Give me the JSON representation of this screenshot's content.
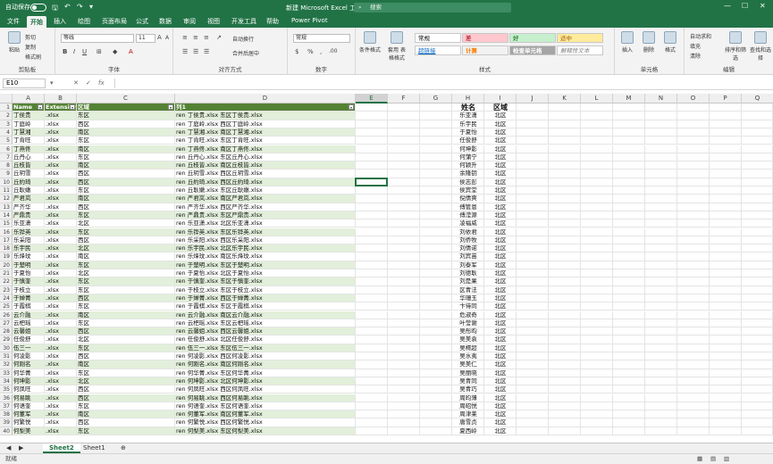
{
  "titlebar": {
    "autosave_label": "自动保存",
    "autosave_state": "关",
    "doc_title": "新建 Microsoft Excel 工作表.xlsx",
    "search_placeholder": "搜索"
  },
  "tabs": [
    "文件",
    "开始",
    "插入",
    "绘图",
    "页面布局",
    "公式",
    "数据",
    "审阅",
    "视图",
    "开发工具",
    "帮助",
    "Power Pivot"
  ],
  "ribbon": {
    "clipboard": {
      "paste": "粘贴",
      "cut": "剪切",
      "copy": "复制",
      "format_painter": "格式刷",
      "label": "剪贴板"
    },
    "font": {
      "name": "等线",
      "size": "11",
      "label": "字体"
    },
    "align": {
      "wrap": "自动换行",
      "merge": "合并后居中",
      "label": "对齐方式"
    },
    "number": {
      "format": "常规",
      "label": "数字"
    },
    "styles": {
      "cond_format": "条件格式",
      "table_format": "套用\n表格格式",
      "label": "样式",
      "boxes": [
        "常规",
        "差",
        "好",
        "适中",
        "超链接",
        "计算",
        "检查单元格",
        "解释性文本"
      ]
    },
    "cells": {
      "insert": "插入",
      "delete": "删除",
      "format": "格式",
      "label": "单元格"
    },
    "editing": {
      "autosum": "自动求和",
      "fill": "填充",
      "clear": "清除",
      "sort": "排序和筛选",
      "find": "查找和选择",
      "label": "编辑"
    }
  },
  "formula_bar": {
    "name_box": "E10",
    "fx": "fx",
    "formula": ""
  },
  "columns": [
    "A",
    "B",
    "C",
    "D",
    "E",
    "F",
    "G",
    "H",
    "I",
    "J",
    "K",
    "L",
    "M",
    "N",
    "O",
    "P",
    "Q",
    "R"
  ],
  "table": {
    "headers": [
      "Name",
      "Extension",
      "区域",
      "列1"
    ],
    "rows": [
      [
        "丁侯贵",
        ".xlsx",
        "东区",
        "ren 丁侯贵.xlsx 东区丁侯贵.xlsx"
      ],
      [
        "丁庭岭",
        ".xlsx",
        "西区",
        "ren 丁庭岭.xlsx 西区丁庭岭.xlsx"
      ],
      [
        "丁慧湘",
        ".xlsx",
        "南区",
        "ren 丁慧湘.xlsx 南区丁慧湘.xlsx"
      ],
      [
        "丁肯旺",
        ".xlsx",
        "东区",
        "ren 丁肯旺.xlsx 东区丁肯旺.xlsx"
      ],
      [
        "丁燕佟",
        ".xlsx",
        "南区",
        "ren 丁燕佟.xlsx 南区丁燕佟.xlsx"
      ],
      [
        "丘丹心",
        ".xlsx",
        "东区",
        "ren 丘丹心.xlsx 东区丘丹心.xlsx"
      ],
      [
        "丘枝皆",
        ".xlsx",
        "南区",
        "ren 丘枝皆.xlsx 南区丘枝皆.xlsx"
      ],
      [
        "丘玥雪",
        ".xlsx",
        "西区",
        "ren 丘玥雪.xlsx 西区丘玥雪.xlsx"
      ],
      [
        "丘約琦",
        ".xlsx",
        "西区",
        "ren 丘約琦.xlsx 西区丘約琦.xlsx"
      ],
      [
        "丘耿嫩",
        ".xlsx",
        "东区",
        "ren 丘耿嫩.xlsx 东区丘耿嫩.xlsx"
      ],
      [
        "严君岚",
        ".xlsx",
        "南区",
        "ren 严君岚.xlsx 南区严君岚.xlsx"
      ],
      [
        "严齐华",
        ".xlsx",
        "西区",
        "ren 严齐华.xlsx 西区严齐华.xlsx"
      ],
      [
        "严鼎贵",
        ".xlsx",
        "东区",
        "ren 严鼎贵.xlsx 东区严鼎贵.xlsx"
      ],
      [
        "乐亚潇",
        ".xlsx",
        "北区",
        "ren 乐亚潇.xlsx 北区乐亚潇.xlsx"
      ],
      [
        "乐铧英",
        ".xlsx",
        "东区",
        "ren 乐铧英.xlsx 东区乐铧英.xlsx"
      ],
      [
        "乐采阳",
        ".xlsx",
        "西区",
        "ren 乐采阳.xlsx 西区乐采阳.xlsx"
      ],
      [
        "乐宇民",
        ".xlsx",
        "北区",
        "ren 乐宇民.xlsx 北区乐宇民.xlsx"
      ],
      [
        "乐烽玟",
        ".xlsx",
        "南区",
        "ren 乐烽玟.xlsx 南区乐烽玟.xlsx"
      ],
      [
        "于楚明",
        ".xlsx",
        "东区",
        "ren 于楚明.xlsx 东区于楚明.xlsx"
      ],
      [
        "于夏怡",
        ".xlsx",
        "北区",
        "ren 于夏怡.xlsx 北区于夏怡.xlsx"
      ],
      [
        "于慎奎",
        ".xlsx",
        "东区",
        "ren 于慎奎.xlsx 东区于慎奎.xlsx"
      ],
      [
        "于枝立",
        ".xlsx",
        "东区",
        "ren 于枝立.xlsx 东区于枝立.xlsx"
      ],
      [
        "于婵菁",
        ".xlsx",
        "西区",
        "ren 于婵菁.xlsx 西区于婵菁.xlsx"
      ],
      [
        "于霞棋",
        ".xlsx",
        "东区",
        "ren 于霞棋.xlsx 东区于霞棋.xlsx"
      ],
      [
        "云介融",
        ".xlsx",
        "南区",
        "ren 云介融.xlsx 南区云介融.xlsx"
      ],
      [
        "云杷瑶",
        ".xlsx",
        "东区",
        "ren 云杷瑶.xlsx 东区云杷瑶.xlsx"
      ],
      [
        "云馨姐",
        ".xlsx",
        "西区",
        "ren 云馨姐.xlsx 西区云馨姐.xlsx"
      ],
      [
        "任俊舒",
        ".xlsx",
        "北区",
        "ren 任俊舒.xlsx 北区任俊舒.xlsx"
      ],
      [
        "伍三一",
        ".xlsx",
        "东区",
        "ren 伍三一.xlsx 东区伍三一.xlsx"
      ],
      [
        "何凌影",
        ".xlsx",
        "西区",
        "ren 何凌影.xlsx 西区何凌影.xlsx"
      ],
      [
        "何刚名",
        ".xlsx",
        "南区",
        "ren 何刚名.xlsx 南区何刚名.xlsx"
      ],
      [
        "何华菁",
        ".xlsx",
        "东区",
        "ren 何华菁.xlsx 东区何华菁.xlsx"
      ],
      [
        "何坤影",
        ".xlsx",
        "北区",
        "ren 何坤影.xlsx 北区何坤影.xlsx"
      ],
      [
        "何凤旺",
        ".xlsx",
        "西区",
        "ren 何凤旺.xlsx 西区何凤旺.xlsx"
      ],
      [
        "何易眺",
        ".xlsx",
        "西区",
        "ren 何易眺.xlsx 西区何易眺.xlsx"
      ],
      [
        "何语奎",
        ".xlsx",
        "东区",
        "ren 何语奎.xlsx 东区何语奎.xlsx"
      ],
      [
        "何董军",
        ".xlsx",
        "南区",
        "ren 何董军.xlsx 南区何董军.xlsx"
      ],
      [
        "何繁悦",
        ".xlsx",
        "西区",
        "ren 何繁悦.xlsx 西区何繁悦.xlsx"
      ],
      [
        "何梨美",
        ".xlsx",
        "东区",
        "ren 何梨美.xlsx 东区何梨美.xlsx"
      ]
    ]
  },
  "side_list": {
    "headers": [
      "姓名",
      "区域"
    ],
    "rows": [
      [
        "乐亚潇",
        "北区"
      ],
      [
        "乐宇民",
        "北区"
      ],
      [
        "于夏怡",
        "北区"
      ],
      [
        "任俊舒",
        "北区"
      ],
      [
        "何坤影",
        "北区"
      ],
      [
        "何蒲宁",
        "北区"
      ],
      [
        "何颖升",
        "北区"
      ],
      [
        "余隆钥",
        "北区"
      ],
      [
        "侯志彭",
        "北区"
      ],
      [
        "侯宾堂",
        "北区"
      ],
      [
        "倪倩爽",
        "北区"
      ],
      [
        "傅管恩",
        "北区"
      ],
      [
        "傅滢源",
        "北区"
      ],
      [
        "凌福威",
        "北区"
      ],
      [
        "刘依君",
        "北区"
      ],
      [
        "刘侨牧",
        "北区"
      ],
      [
        "刘倩诺",
        "北区"
      ],
      [
        "刘宾苗",
        "北区"
      ],
      [
        "刘泰军",
        "北区"
      ],
      [
        "刘德耿",
        "北区"
      ],
      [
        "刘是果",
        "北区"
      ],
      [
        "区青法",
        "北区"
      ],
      [
        "华珊玉",
        "北区"
      ],
      [
        "卞待同",
        "北区"
      ],
      [
        "危淑奇",
        "北区"
      ],
      [
        "叶莹谢",
        "北区"
      ],
      [
        "吴彤昀",
        "北区"
      ],
      [
        "吴美袁",
        "北区"
      ],
      [
        "吴樗超",
        "北区"
      ],
      [
        "吴水夷",
        "北区"
      ],
      [
        "吴美仁",
        "北区"
      ],
      [
        "吴丽晓",
        "北区"
      ],
      [
        "吴青同",
        "北区"
      ],
      [
        "吴青巧",
        "北区"
      ],
      [
        "周昀薄",
        "北区"
      ],
      [
        "周昭悦",
        "北区"
      ],
      [
        "周津莱",
        "北区"
      ],
      [
        "唐雪贞",
        "北区"
      ],
      [
        "夏西岭",
        "北区"
      ]
    ]
  },
  "sheets": [
    "Sheet2",
    "Sheet1"
  ],
  "status": {
    "mode": "就绪"
  },
  "colors": {
    "accent": "#217346",
    "table_header": "#548235",
    "stripe": "#e2efda"
  }
}
